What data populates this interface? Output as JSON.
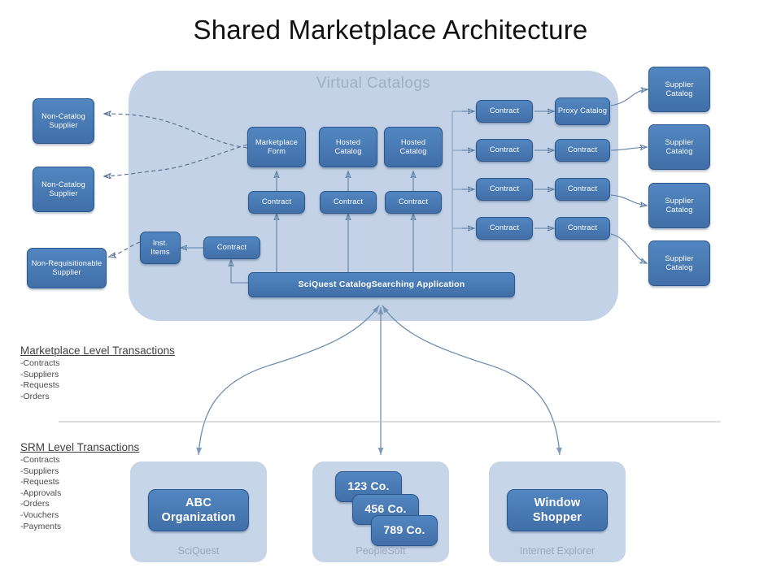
{
  "title": "Shared Marketplace Architecture",
  "colors": {
    "node_fill": "#4a7ebb",
    "node_border": "#2f568c",
    "panel_fill": "#c3d2e6",
    "panel_caption": "#9aa9bd",
    "arrow": "#5b7fa6",
    "title_text": "#111111"
  },
  "virtual_catalogs": {
    "label": "Virtual Catalogs",
    "catalog_row": [
      {
        "label": "Marketplace Form"
      },
      {
        "label": "Hosted Catalog"
      },
      {
        "label": "Hosted Catalog"
      }
    ],
    "contract_row": [
      {
        "label": "Contract"
      },
      {
        "label": "Contract"
      },
      {
        "label": "Contract"
      }
    ],
    "inst_items": {
      "label": "Inst. Items"
    },
    "inst_contract": {
      "label": "Contract"
    },
    "right_contracts": [
      {
        "label": "Contract"
      },
      {
        "label": "Contract"
      },
      {
        "label": "Contract"
      },
      {
        "label": "Contract"
      }
    ],
    "right_targets": [
      {
        "label": "Proxy Catalog"
      },
      {
        "label": "Contract"
      },
      {
        "label": "Contract"
      },
      {
        "label": "Contract"
      }
    ],
    "application_bar": {
      "label": "SciQuest CatalogSearching Application"
    }
  },
  "left_suppliers": [
    {
      "label": "Non-Catalog Supplier"
    },
    {
      "label": "Non-Catalog Supplier"
    },
    {
      "label": "Non-Requisitionable Supplier"
    }
  ],
  "supplier_catalogs": [
    {
      "label": "Supplier Catalog"
    },
    {
      "label": "Supplier Catalog"
    },
    {
      "label": "Supplier Catalog"
    },
    {
      "label": "Supplier Catalog"
    }
  ],
  "marketplace_transactions": {
    "heading": "Marketplace Level Transactions",
    "items": [
      "-Contracts",
      "-Suppliers",
      "-Requests",
      "-Orders"
    ]
  },
  "srm_transactions": {
    "heading": "SRM Level Transactions",
    "items": [
      "-Contracts",
      "-Suppliers",
      "-Requests",
      "-Approvals",
      "-Orders",
      "-Vouchers",
      "-Payments"
    ]
  },
  "bottom_panels": [
    {
      "caption": "SciQuest",
      "nodes": [
        {
          "label": "ABC Organization"
        }
      ]
    },
    {
      "caption": "PeopleSoft",
      "nodes": [
        {
          "label": "123 Co."
        },
        {
          "label": "456  Co."
        },
        {
          "label": "789 Co."
        }
      ]
    },
    {
      "caption": "Internet Explorer",
      "nodes": [
        {
          "label": "Window Shopper"
        }
      ]
    }
  ]
}
